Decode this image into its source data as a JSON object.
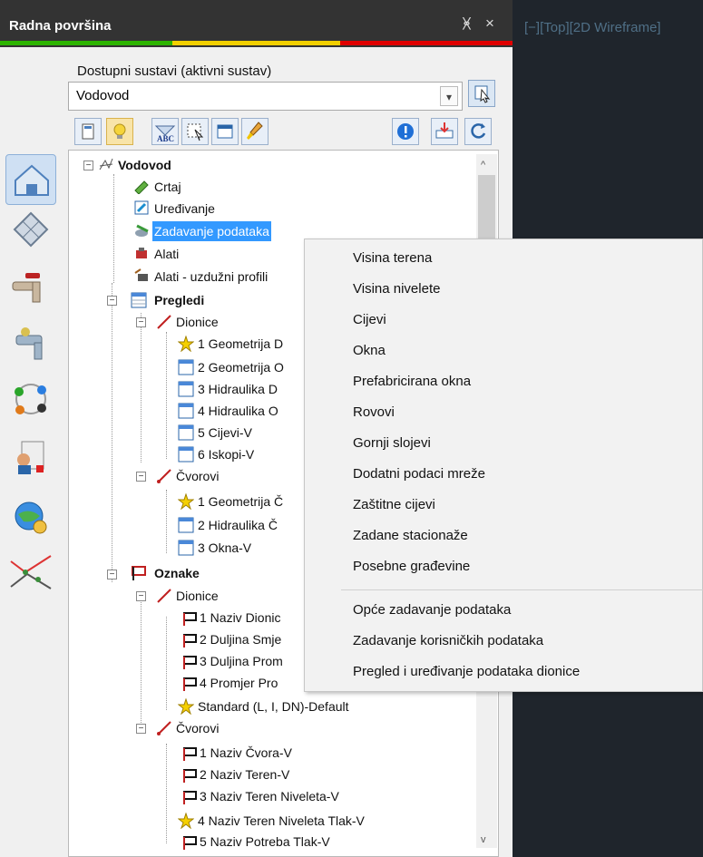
{
  "window": {
    "title": "Radna površina",
    "pin_glyph": "ᚸ",
    "close_glyph": "×",
    "viewport_label": "[−][Top][2D Wireframe]"
  },
  "systems": {
    "label": "Dostupni sustavi (aktivni sustav)",
    "value": "Vodovod"
  },
  "tree": {
    "root": "Vodovod",
    "items": [
      "Crtaj",
      "Uređivanje",
      "Zadavanje podataka",
      "Alati",
      "Alati - uzdužni profili"
    ],
    "pregledi": "Pregledi",
    "dionice_label": "Dionice",
    "pregledi_dionice": [
      "1 Geometrija D",
      "2 Geometrija O",
      "3 Hidraulika D",
      "4 Hidraulika O",
      "5 Cijevi-V",
      "6 Iskopi-V"
    ],
    "cvorovi_label": "Čvorovi",
    "pregledi_cvorovi": [
      "1 Geometrija Č",
      "2 Hidraulika Č",
      "3 Okna-V"
    ],
    "oznake": "Oznake",
    "oznake_dionice": [
      "1 Naziv Dionic",
      "2 Duljina Smje",
      "3 Duljina Prom",
      "4 Promjer Pro",
      "Standard (L, I, DN)-Default"
    ],
    "oznake_cvorovi": [
      "1 Naziv Čvora-V",
      "2 Naziv Teren-V",
      "3 Naziv Teren Niveleta-V",
      "4 Naziv Teren Niveleta Tlak-V",
      "5 Naziv Potreba Tlak-V"
    ]
  },
  "context_menu": {
    "items": [
      "Visina terena",
      "Visina nivelete",
      "Cijevi",
      "Okna",
      "Prefabricirana okna",
      "Rovovi",
      "Gornji slojevi",
      "Dodatni podaci mreže",
      "Zaštitne cijevi",
      "Zadane stacionaže",
      "Posebne građevine"
    ],
    "items2": [
      "Opće zadavanje podataka",
      "Zadavanje korisničkih podataka",
      "Pregled i uređivanje podataka dionice"
    ]
  },
  "colors": {
    "accent_green": "#2db400",
    "accent_yellow": "#f2d000",
    "accent_red": "#e00000",
    "selection": "#3399ff"
  }
}
